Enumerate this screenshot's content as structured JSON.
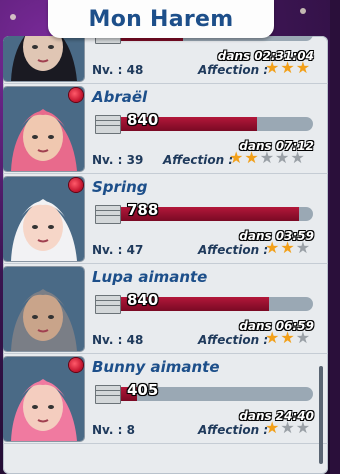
{
  "header": {
    "title": "Mon Harem"
  },
  "colors": {
    "accent": "#1d4f8a",
    "bar": "#b3173a",
    "star_on": "#f2a01a",
    "star_off": "#9aa0a6"
  },
  "list": [
    {
      "name": "",
      "amount": "",
      "timer": "dans 02:31:04",
      "level_label": "Nv. : 48",
      "affection_label": "Affection :",
      "stars": 3,
      "max_stars": 3,
      "progress": 0.35,
      "skin": "#e0c6b4",
      "hair": "#1a1a22",
      "show_rose": false
    },
    {
      "name": "Abraël",
      "amount": "840",
      "timer": "dans 07:12",
      "level_label": "Nv. : 39",
      "affection_label": "Affection :",
      "stars": 2,
      "max_stars": 5,
      "progress": 0.72,
      "skin": "#f0c8b0",
      "hair": "#e86a8c",
      "show_rose": true
    },
    {
      "name": "Spring",
      "amount": "788",
      "timer": "dans 03:59",
      "level_label": "Nv. : 47",
      "affection_label": "Affection :",
      "stars": 2,
      "max_stars": 3,
      "progress": 0.93,
      "skin": "#f6d6c8",
      "hair": "#f2f2f4",
      "show_rose": true
    },
    {
      "name": "Lupa aimante",
      "amount": "840",
      "timer": "dans 06:59",
      "level_label": "Nv. : 48",
      "affection_label": "Affection :",
      "stars": 2,
      "max_stars": 3,
      "progress": 0.78,
      "skin": "#c9a48a",
      "hair": "#7a7e86",
      "show_rose": false
    },
    {
      "name": "Bunny aimante",
      "amount": "405",
      "timer": "dans 24:40",
      "level_label": "Nv. : 8",
      "affection_label": "Affection :",
      "stars": 1,
      "max_stars": 3,
      "progress": 0.12,
      "skin": "#f4cdbf",
      "hair": "#f07aa0",
      "show_rose": true
    }
  ]
}
